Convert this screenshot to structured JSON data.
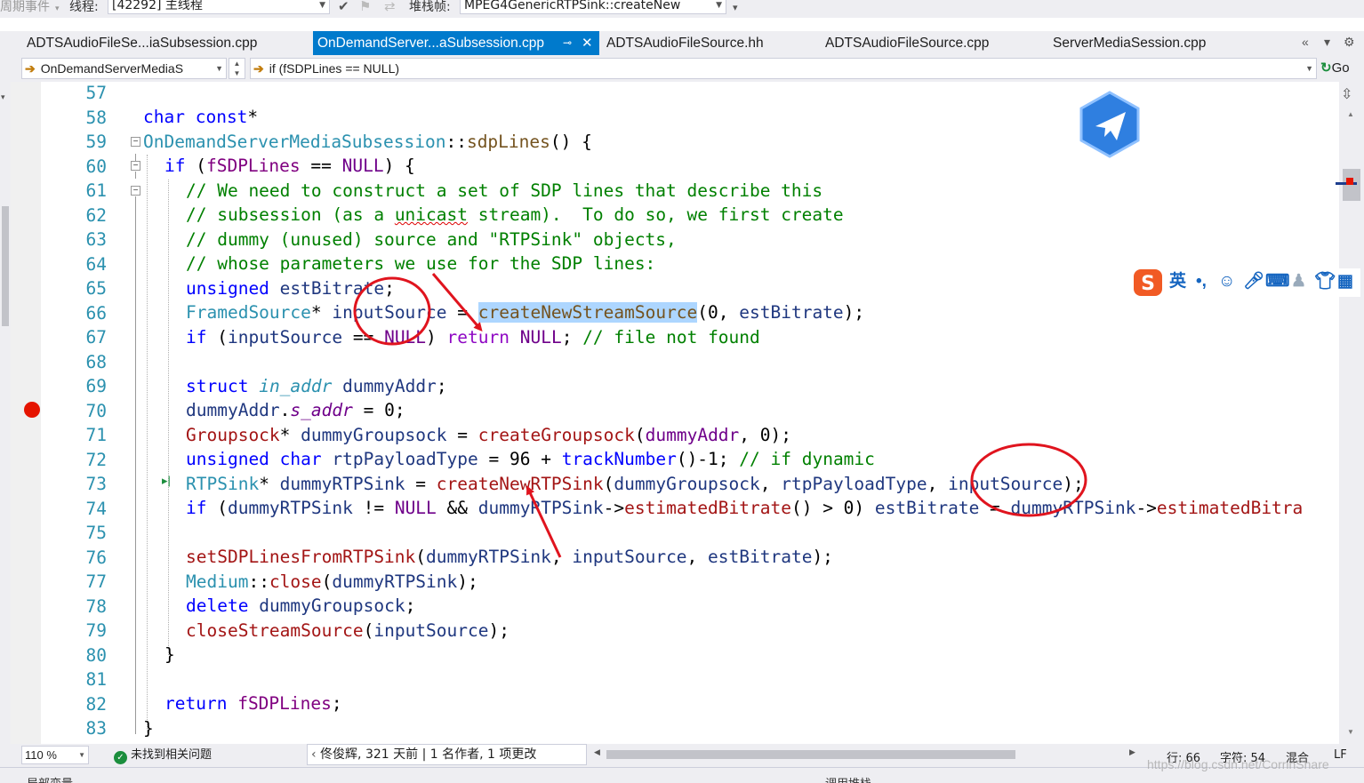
{
  "debug_bar": {
    "lifecycle_label": "周期事件",
    "thread_label": "线程:",
    "thread_value": "[42292] 主线程",
    "stack_label": "堆栈帧:",
    "stack_value": "MPEG4GenericRTPSink::createNew"
  },
  "tabs": [
    {
      "label": "ADTSAudioFileSe...iaSubsession.cpp",
      "active": false
    },
    {
      "label": "OnDemandServer...aSubsession.cpp",
      "active": true
    },
    {
      "label": "ADTSAudioFileSource.hh",
      "active": false
    },
    {
      "label": "ADTSAudioFileSource.cpp",
      "active": false
    },
    {
      "label": "ServerMediaSession.cpp",
      "active": false
    }
  ],
  "tab_tools": {
    "overflow": "«",
    "dropdown": "▾",
    "settings": "⚙"
  },
  "nav": {
    "scope_value": "OnDemandServerMediaS",
    "member_value": "if (fSDPLines == NULL)",
    "go_label": "Go"
  },
  "code_lines": [
    {
      "n": "57"
    },
    {
      "n": "58"
    },
    {
      "n": "59"
    },
    {
      "n": "60"
    },
    {
      "n": "61"
    },
    {
      "n": "62"
    },
    {
      "n": "63"
    },
    {
      "n": "64"
    },
    {
      "n": "65"
    },
    {
      "n": "66"
    },
    {
      "n": "67"
    },
    {
      "n": "68"
    },
    {
      "n": "69"
    },
    {
      "n": "70"
    },
    {
      "n": "71"
    },
    {
      "n": "72"
    },
    {
      "n": "73"
    },
    {
      "n": "74"
    },
    {
      "n": "75"
    },
    {
      "n": "76"
    },
    {
      "n": "77"
    },
    {
      "n": "78"
    },
    {
      "n": "79"
    },
    {
      "n": "80"
    },
    {
      "n": "81"
    },
    {
      "n": "82"
    },
    {
      "n": "83"
    }
  ],
  "code": {
    "l58": {
      "a": "char",
      "b": " ",
      "c": "const",
      "d": "*"
    },
    "l59": {
      "a": "OnDemandServerMediaSubsession",
      "b": "::",
      "c": "sdpLines",
      "d": "() {"
    },
    "l60": {
      "a": "if",
      "b": " (",
      "c": "fSDPLines",
      "d": " == ",
      "e": "NULL",
      "f": ") {"
    },
    "l61": "// We need to construct a set of SDP lines that describe this",
    "l62": {
      "a": "// subsession (as a ",
      "b": "unicast",
      "c": " stream).  To do so, we first create"
    },
    "l63": "// dummy (unused) source and \"RTPSink\" objects,",
    "l64": "// whose parameters we use for the SDP lines:",
    "l65": {
      "a": "unsigned",
      "b": " ",
      "c": "estBitrate",
      "d": ";"
    },
    "l66": {
      "a": "FramedSource",
      "b": "* ",
      "c": "inputSource",
      "d": " = ",
      "e": "createNewStreamSource",
      "f": "(0, ",
      "g": "estBitrate",
      "h": ");"
    },
    "l67": {
      "a": "if",
      "b": " (",
      "c": "inputSource",
      "d": " == ",
      "e": "NULL",
      "f": ") ",
      "g": "return",
      "h": " ",
      "i": "NULL",
      "j": "; ",
      "k": "// file not found"
    },
    "l69": {
      "a": "struct",
      "b": " ",
      "c": "in_addr",
      "d": " ",
      "e": "dummyAddr",
      "f": ";"
    },
    "l70": {
      "a": "dummyAddr",
      "b": ".",
      "c": "s_addr",
      "d": " = 0;"
    },
    "l71": {
      "a": "Groupsock",
      "b": "* ",
      "c": "dummyGroupsock",
      "d": " = ",
      "e": "createGroupsock",
      "f": "(",
      "g": "dummyAddr",
      "h": ", 0);"
    },
    "l72": {
      "a": "unsigned",
      "b": " ",
      "c": "char",
      "d": " ",
      "e": "rtpPayloadType",
      "f": " = 96 + ",
      "g": "trackNumber",
      "h": "()-1; ",
      "i": "// if dynamic"
    },
    "l73": {
      "a": "RTPSink",
      "b": "* ",
      "c": "dummyRTPSink",
      "d": " = ",
      "e": "createNewRTPSink",
      "f": "(",
      "g": "dummyGroupsock",
      "h": ", ",
      "i": "rtpPayloadType",
      "j": ", ",
      "k": "inputSource",
      "l": ");"
    },
    "l74": {
      "a": "if",
      "b": " (",
      "c": "dummyRTPSink",
      "d": " != ",
      "e": "NULL",
      "f": " && ",
      "g": "dummyRTPSink",
      "h": "->",
      "i": "estimatedBitrate",
      "j": "() > 0) ",
      "k": "estBitrate",
      "l": " = ",
      "m": "dummyRTPSink",
      "n": "->",
      "o": "estimatedBitra"
    },
    "l76": {
      "a": "setSDPLinesFromRTPSink",
      "b": "(",
      "c": "dummyRTPSink",
      "d": ", ",
      "e": "inputSource",
      "f": ", ",
      "g": "estBitrate",
      "h": ");"
    },
    "l77": {
      "a": "Medium",
      "b": "::",
      "c": "close",
      "d": "(",
      "e": "dummyRTPSink",
      "f": ");"
    },
    "l78": {
      "a": "delete",
      "b": " ",
      "c": "dummyGroupsock",
      "d": ";"
    },
    "l79": {
      "a": "closeStreamSource",
      "b": "(",
      "c": "inputSource",
      "d": ");"
    },
    "l80": "}",
    "l82": {
      "a": "return",
      "b": " ",
      "c": "fSDPLines",
      "d": ";"
    },
    "l83": "}"
  },
  "status": {
    "zoom": "110 %",
    "issues": "未找到相关问题",
    "codelens": "佟俊辉, 321 天前 | 1 名作者, 1 项更改",
    "line": "行: 66",
    "char": "字符: 54",
    "mixed": "混合",
    "eol": "LF"
  },
  "bottom_panels": {
    "left": "局部变量",
    "right": "调用堆栈"
  },
  "watermark": "https://blog.csdn.net/CorrinShare",
  "ime_toolbar": {
    "lang": "英",
    "punct": "•,"
  },
  "icons": [
    "back-arrow-icon",
    "forward-arrow-icon",
    "bird-app-icon",
    "sogou-logo-icon",
    "check-icon",
    "breakpoint-icon"
  ],
  "colors": {
    "accent": "#007acc",
    "breakpoint": "#e51400",
    "annotation": "#e0141e",
    "keyword": "#0000ff",
    "type": "#2b91af",
    "comment": "#008000"
  }
}
